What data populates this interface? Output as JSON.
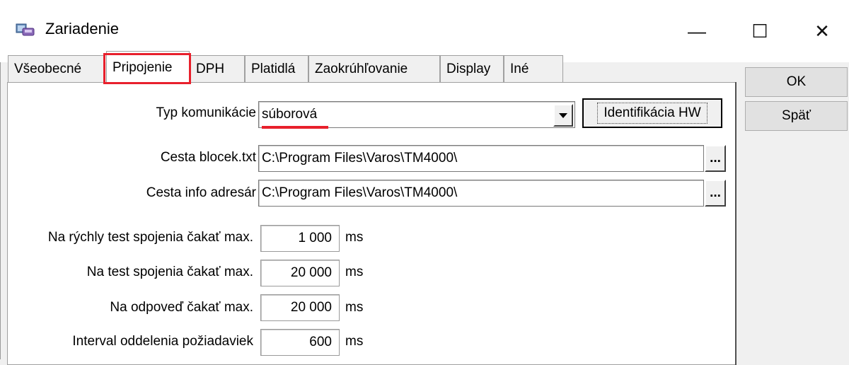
{
  "window": {
    "title": "Zariadenie",
    "minimize_glyph": "—",
    "maximize_glyph": "☐",
    "close_glyph": "✕"
  },
  "tabs": [
    {
      "label": "Všeobecné",
      "active": false
    },
    {
      "label": "Pripojenie",
      "active": true
    },
    {
      "label": "DPH",
      "active": false
    },
    {
      "label": "Platidlá",
      "active": false
    },
    {
      "label": "Zaokrúhľovanie",
      "active": false
    },
    {
      "label": "Display",
      "active": false
    },
    {
      "label": "Iné",
      "active": false
    }
  ],
  "form": {
    "typ_label": "Typ komunikácie",
    "typ_value": "súborová",
    "hw_button": "Identifikácia HW",
    "cesta_blocek_label": "Cesta blocek.txt",
    "cesta_blocek_value": "C:\\Program Files\\Varos\\TM4000\\",
    "cesta_info_label": "Cesta info adresár",
    "cesta_info_value": "C:\\Program Files\\Varos\\TM4000\\",
    "browse_label": "...",
    "rychly_test_label": "Na rýchly test spojenia čakať max.",
    "rychly_test_value": "1 000",
    "test_label": "Na test spojenia čakať max.",
    "test_value": "20 000",
    "odpoved_label": "Na odpoveď čakať max.",
    "odpoved_value": "20 000",
    "interval_label": "Interval oddelenia požiadaviek",
    "interval_value": "600",
    "unit": "ms"
  },
  "buttons": {
    "ok": "OK",
    "back": "Späť"
  },
  "colors": {
    "highlight": "#e8202c",
    "panel": "#ffffff",
    "window": "#f0f0f0"
  }
}
